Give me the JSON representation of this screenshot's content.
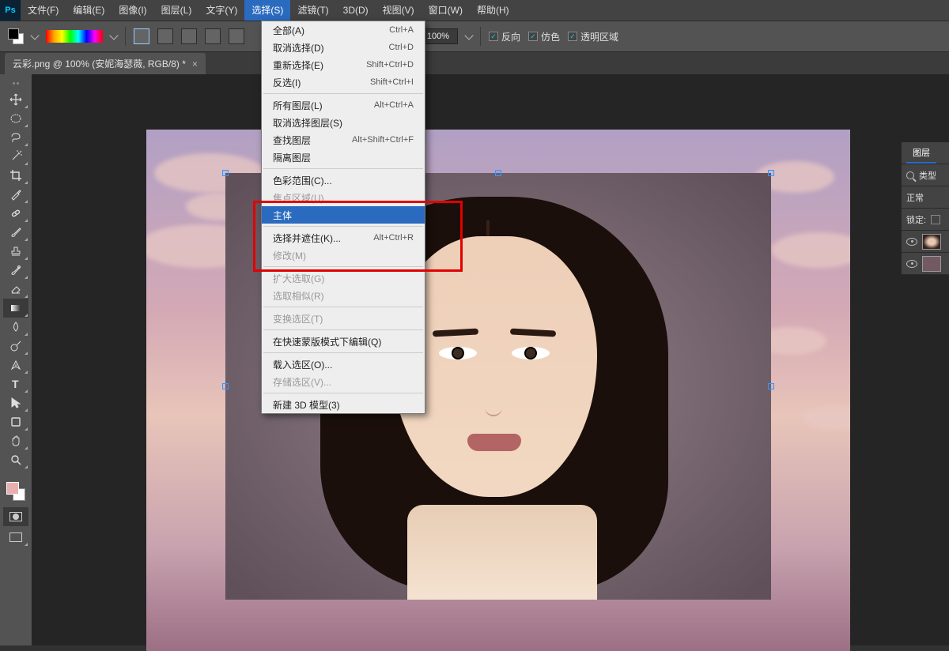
{
  "app": {
    "logo": "Ps"
  },
  "menubar": {
    "items": [
      "文件(F)",
      "编辑(E)",
      "图像(I)",
      "图层(L)",
      "文字(Y)",
      "选择(S)",
      "滤镜(T)",
      "3D(D)",
      "视图(V)",
      "窗口(W)",
      "帮助(H)"
    ],
    "active_index": 5
  },
  "optionbar": {
    "zoom_value": "100%",
    "cb_reverse": "反向",
    "cb_dither": "仿色",
    "cb_transparent": "透明区域"
  },
  "tab": {
    "title": "云彩.png @ 100% (安妮海瑟薇, RGB/8) *",
    "close": "×"
  },
  "dropdown": {
    "groups": [
      [
        {
          "label": "全部(A)",
          "shortcut": "Ctrl+A",
          "state": "n"
        },
        {
          "label": "取消选择(D)",
          "shortcut": "Ctrl+D",
          "state": "n"
        },
        {
          "label": "重新选择(E)",
          "shortcut": "Shift+Ctrl+D",
          "state": "n"
        },
        {
          "label": "反选(I)",
          "shortcut": "Shift+Ctrl+I",
          "state": "n"
        }
      ],
      [
        {
          "label": "所有图层(L)",
          "shortcut": "Alt+Ctrl+A",
          "state": "n"
        },
        {
          "label": "取消选择图层(S)",
          "shortcut": "",
          "state": "n"
        },
        {
          "label": "查找图层",
          "shortcut": "Alt+Shift+Ctrl+F",
          "state": "n"
        },
        {
          "label": "隔离图层",
          "shortcut": "",
          "state": "n"
        }
      ],
      [
        {
          "label": "色彩范围(C)...",
          "shortcut": "",
          "state": "n"
        },
        {
          "label": "焦点区域(U)...",
          "shortcut": "",
          "state": "dis"
        },
        {
          "label": "主体",
          "shortcut": "",
          "state": "sel"
        }
      ],
      [
        {
          "label": "选择并遮住(K)...",
          "shortcut": "Alt+Ctrl+R",
          "state": "n"
        },
        {
          "label": "修改(M)",
          "shortcut": "",
          "state": "dis"
        }
      ],
      [
        {
          "label": "扩大选取(G)",
          "shortcut": "",
          "state": "dis"
        },
        {
          "label": "选取相似(R)",
          "shortcut": "",
          "state": "dis"
        }
      ],
      [
        {
          "label": "变换选区(T)",
          "shortcut": "",
          "state": "dis"
        }
      ],
      [
        {
          "label": "在快速蒙版模式下编辑(Q)",
          "shortcut": "",
          "state": "n"
        }
      ],
      [
        {
          "label": "载入选区(O)...",
          "shortcut": "",
          "state": "n"
        },
        {
          "label": "存储选区(V)...",
          "shortcut": "",
          "state": "dis"
        }
      ],
      [
        {
          "label": "新建 3D 模型(3)",
          "shortcut": "",
          "state": "n"
        }
      ]
    ]
  },
  "tools": [
    "move",
    "marquee",
    "lasso",
    "wand",
    "crop",
    "eyedropper",
    "healing",
    "brush",
    "stamp",
    "history",
    "eraser",
    "gradient",
    "blur",
    "dodge",
    "pen",
    "type",
    "path",
    "shape",
    "hand",
    "zoom"
  ],
  "layers_panel": {
    "tabs": [
      "图层"
    ],
    "search_label": "类型",
    "blend_mode": "正常",
    "lock_label": "锁定:",
    "layers": [
      {
        "visible": true,
        "kind": "portrait"
      },
      {
        "visible": true,
        "kind": "bg"
      }
    ]
  }
}
